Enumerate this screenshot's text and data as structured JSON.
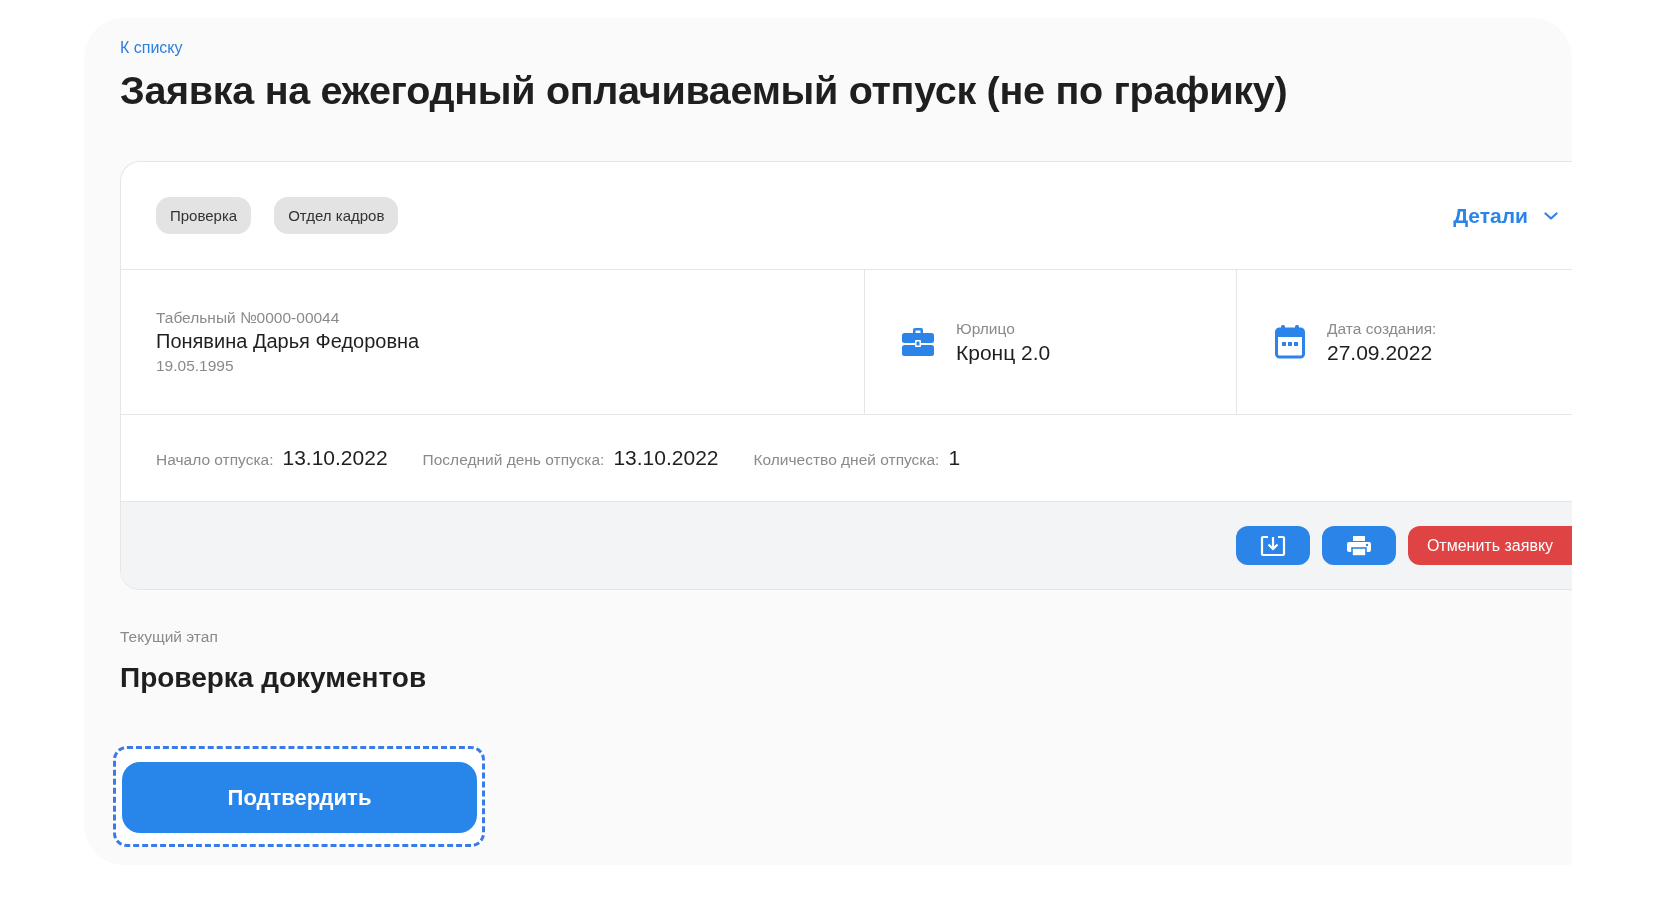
{
  "back_link": "К списку",
  "title": "Заявка на ежегодный оплачиваемый отпуск (не по графику)",
  "tags": [
    "Проверка",
    "Отдел кадров"
  ],
  "details_toggle": {
    "label": "Детали",
    "expanded": false
  },
  "employee": {
    "tab_number": "Табельный №0000-00044",
    "name": "Понявина Дарья Федоровна",
    "birth_date": "19.05.1995"
  },
  "info": [
    {
      "kind": "company",
      "label": "Юрлицо",
      "value": "Кронц 2.0"
    },
    {
      "kind": "date",
      "label": "Дата создания:",
      "value": "27.09.2022"
    }
  ],
  "vacation": [
    {
      "label": "Начало отпуска:",
      "value": "13.10.2022"
    },
    {
      "label": "Последний день отпуска:",
      "value": "13.10.2022"
    },
    {
      "label": "Количество дней отпуска:",
      "value": "1"
    }
  ],
  "actions": [
    {
      "kind": "download"
    },
    {
      "kind": "print"
    },
    {
      "kind": "danger",
      "label": "Отменить заявку"
    }
  ],
  "stage": {
    "caption": "Текущий этап",
    "name": "Проверка документов"
  },
  "confirm_button": {
    "label": "Подтвердить",
    "focused": true
  }
}
